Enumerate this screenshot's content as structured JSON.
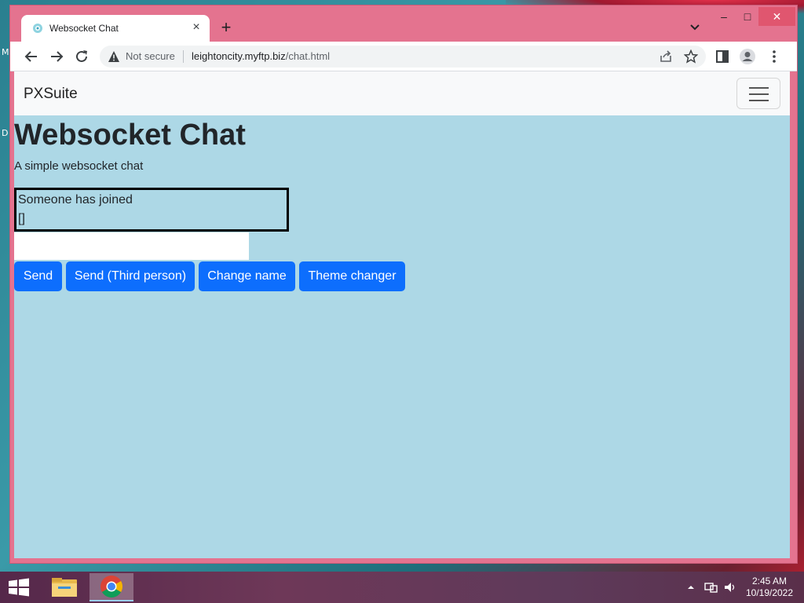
{
  "desktop": {
    "edge_glyph_1": "M",
    "edge_glyph_2": "D"
  },
  "browser": {
    "tab": {
      "title": "Websocket Chat",
      "close": "×"
    },
    "new_tab": "+",
    "window_controls": {
      "minimize": "–",
      "maximize": "□",
      "close": "✕"
    },
    "address": {
      "security_label": "Not secure",
      "host": "leightoncity.myftp.biz",
      "path": "/chat.html"
    }
  },
  "page": {
    "navbar": {
      "brand": "PXSuite"
    },
    "title": "Websocket Chat",
    "subtitle": "A simple websocket chat",
    "chat": {
      "lines": [
        "Someone has joined",
        "[]"
      ]
    },
    "input": {
      "value": "",
      "placeholder": ""
    },
    "buttons": {
      "send": "Send",
      "send_third": "Send (Third person)",
      "change_name": "Change name",
      "theme_changer": "Theme changer"
    }
  },
  "taskbar": {
    "clock": {
      "time": "2:45 AM",
      "date": "10/19/2022"
    },
    "tray_icons": [
      "chevron-up-icon",
      "network-icon",
      "volume-icon"
    ]
  },
  "colors": {
    "page_background": "#add8e6",
    "primary_button": "#0d6efd",
    "window_frame": "#e4738f",
    "navbar": "#f8f9fa"
  }
}
